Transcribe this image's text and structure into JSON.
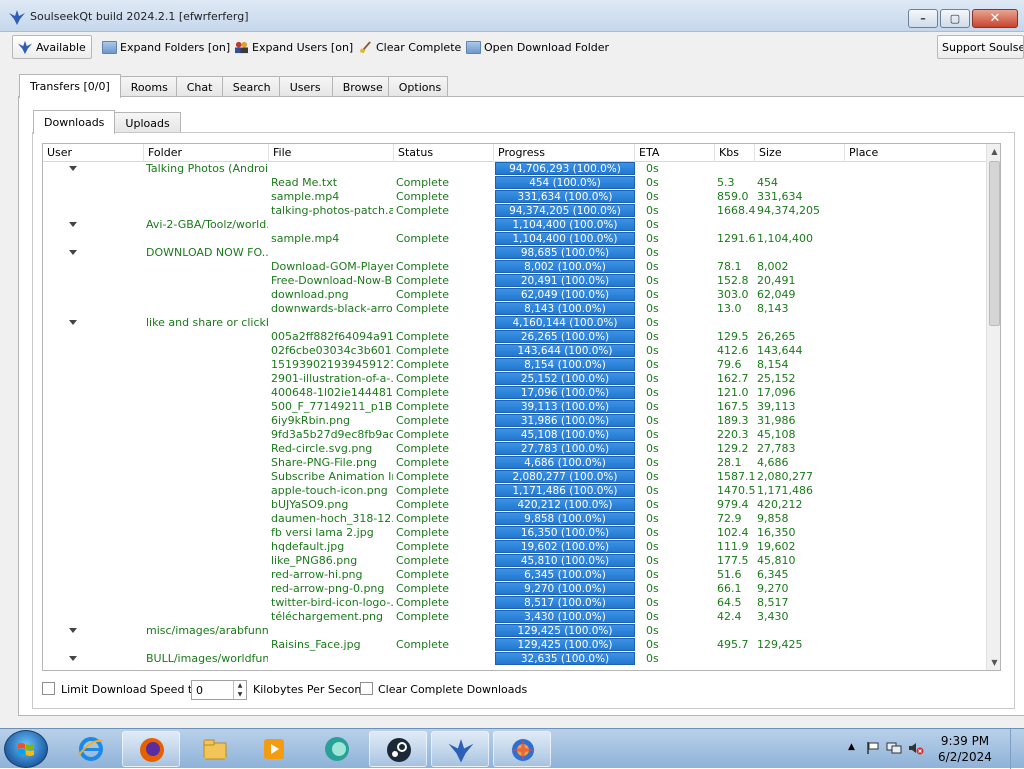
{
  "window": {
    "title": "SoulseekQt build 2024.2.1 [efwrferferg]",
    "minimize": "–",
    "maximize": "▢",
    "close": "✕"
  },
  "toolbar": {
    "available": "Available",
    "expand_folders": "Expand Folders [on]",
    "expand_users": "Expand Users [on]",
    "clear_complete": "Clear Complete",
    "open_download_folder": "Open Download Folder",
    "support": "Support Soulseek"
  },
  "tabs": [
    "Transfers [0/0]",
    "Rooms",
    "Chat",
    "Search",
    "Users",
    "Browse",
    "Options"
  ],
  "subtabs": [
    "Downloads",
    "Uploads"
  ],
  "columns": [
    "User",
    "Folder",
    "File",
    "Status",
    "Progress",
    "ETA",
    "Kbs",
    "Size",
    "Place"
  ],
  "rows": [
    {
      "group": true,
      "folder": "Talking Photos (Androi...",
      "progress": "94,706,293 (100.0%)",
      "eta": "0s"
    },
    {
      "file": "Read Me.txt",
      "status": "Complete",
      "progress": "454 (100.0%)",
      "eta": "0s",
      "kbs": "5.3",
      "size": "454"
    },
    {
      "file": "sample.mp4",
      "status": "Complete",
      "progress": "331,634 (100.0%)",
      "eta": "0s",
      "kbs": "859.0",
      "size": "331,634"
    },
    {
      "file": "talking-photos-patch.a...",
      "status": "Complete",
      "progress": "94,374,205 (100.0%)",
      "eta": "0s",
      "kbs": "1668.4",
      "size": "94,374,205"
    },
    {
      "group": true,
      "folder": "Avi-2-GBA/Toolz/world...",
      "progress": "1,104,400 (100.0%)",
      "eta": "0s"
    },
    {
      "file": "sample.mp4",
      "status": "Complete",
      "progress": "1,104,400 (100.0%)",
      "eta": "0s",
      "kbs": "1291.6",
      "size": "1,104,400"
    },
    {
      "group": true,
      "folder": "DOWNLOAD NOW FO...",
      "progress": "98,685 (100.0%)",
      "eta": "0s"
    },
    {
      "file": "Download-GOM-Player ...",
      "status": "Complete",
      "progress": "8,002 (100.0%)",
      "eta": "0s",
      "kbs": "78.1",
      "size": "8,002"
    },
    {
      "file": "Free-Download-Now-B...",
      "status": "Complete",
      "progress": "20,491 (100.0%)",
      "eta": "0s",
      "kbs": "152.8",
      "size": "20,491"
    },
    {
      "file": "download.png",
      "status": "Complete",
      "progress": "62,049 (100.0%)",
      "eta": "0s",
      "kbs": "303.0",
      "size": "62,049"
    },
    {
      "file": "downwards-black-arro...",
      "status": "Complete",
      "progress": "8,143 (100.0%)",
      "eta": "0s",
      "kbs": "13.0",
      "size": "8,143"
    },
    {
      "group": true,
      "folder": "like and share or clickb...",
      "progress": "4,160,144 (100.0%)",
      "eta": "0s"
    },
    {
      "file": "005a2ff882f64094a91...",
      "status": "Complete",
      "progress": "26,265 (100.0%)",
      "eta": "0s",
      "kbs": "129.5",
      "size": "26,265"
    },
    {
      "file": "02f6cbe03034c3b601...",
      "status": "Complete",
      "progress": "143,644 (100.0%)",
      "eta": "0s",
      "kbs": "412.6",
      "size": "143,644"
    },
    {
      "file": "151939021939459121...",
      "status": "Complete",
      "progress": "8,154 (100.0%)",
      "eta": "0s",
      "kbs": "79.6",
      "size": "8,154"
    },
    {
      "file": "2901-illustration-of-a-...",
      "status": "Complete",
      "progress": "25,152 (100.0%)",
      "eta": "0s",
      "kbs": "162.7",
      "size": "25,152"
    },
    {
      "file": "400648-1l02ie144481...",
      "status": "Complete",
      "progress": "17,096 (100.0%)",
      "eta": "0s",
      "kbs": "121.0",
      "size": "17,096"
    },
    {
      "file": "500_F_77149211_p1B...",
      "status": "Complete",
      "progress": "39,113 (100.0%)",
      "eta": "0s",
      "kbs": "167.5",
      "size": "39,113"
    },
    {
      "file": "6iy9kRbin.png",
      "status": "Complete",
      "progress": "31,986 (100.0%)",
      "eta": "0s",
      "kbs": "189.3",
      "size": "31,986"
    },
    {
      "file": "9fd3a5b27d9ec8fb9ad...",
      "status": "Complete",
      "progress": "45,108 (100.0%)",
      "eta": "0s",
      "kbs": "220.3",
      "size": "45,108"
    },
    {
      "file": "Red-circle.svg.png",
      "status": "Complete",
      "progress": "27,783 (100.0%)",
      "eta": "0s",
      "kbs": "129.2",
      "size": "27,783"
    },
    {
      "file": "Share-PNG-File.png",
      "status": "Complete",
      "progress": "4,686 (100.0%)",
      "eta": "0s",
      "kbs": "28.1",
      "size": "4,686"
    },
    {
      "file": "Subscribe Animation In...",
      "status": "Complete",
      "progress": "2,080,277 (100.0%)",
      "eta": "0s",
      "kbs": "1587.1",
      "size": "2,080,277"
    },
    {
      "file": "apple-touch-icon.png",
      "status": "Complete",
      "progress": "1,171,486 (100.0%)",
      "eta": "0s",
      "kbs": "1470.5",
      "size": "1,171,486"
    },
    {
      "file": "bUJYaSO9.png",
      "status": "Complete",
      "progress": "420,212 (100.0%)",
      "eta": "0s",
      "kbs": "979.4",
      "size": "420,212"
    },
    {
      "file": "daumen-hoch_318-12...",
      "status": "Complete",
      "progress": "9,858 (100.0%)",
      "eta": "0s",
      "kbs": "72.9",
      "size": "9,858"
    },
    {
      "file": "fb versi lama 2.jpg",
      "status": "Complete",
      "progress": "16,350 (100.0%)",
      "eta": "0s",
      "kbs": "102.4",
      "size": "16,350"
    },
    {
      "file": "hqdefault.jpg",
      "status": "Complete",
      "progress": "19,602 (100.0%)",
      "eta": "0s",
      "kbs": "111.9",
      "size": "19,602"
    },
    {
      "file": "like_PNG86.png",
      "status": "Complete",
      "progress": "45,810 (100.0%)",
      "eta": "0s",
      "kbs": "177.5",
      "size": "45,810"
    },
    {
      "file": "red-arrow-hi.png",
      "status": "Complete",
      "progress": "6,345 (100.0%)",
      "eta": "0s",
      "kbs": "51.6",
      "size": "6,345"
    },
    {
      "file": "red-arrow-png-0.png",
      "status": "Complete",
      "progress": "9,270 (100.0%)",
      "eta": "0s",
      "kbs": "66.1",
      "size": "9,270"
    },
    {
      "file": "twitter-bird-icon-logo-...",
      "status": "Complete",
      "progress": "8,517 (100.0%)",
      "eta": "0s",
      "kbs": "64.5",
      "size": "8,517"
    },
    {
      "file": "téléchargement.png",
      "status": "Complete",
      "progress": "3,430 (100.0%)",
      "eta": "0s",
      "kbs": "42.4",
      "size": "3,430"
    },
    {
      "group": true,
      "folder": "misc/images/arabfunn...",
      "progress": "129,425 (100.0%)",
      "eta": "0s"
    },
    {
      "file": "Raisins_Face.jpg",
      "status": "Complete",
      "progress": "129,425 (100.0%)",
      "eta": "0s",
      "kbs": "495.7",
      "size": "129,425"
    },
    {
      "group": true,
      "folder": "BULL/images/worldfun...",
      "progress": "32,635 (100.0%)",
      "eta": "0s"
    }
  ],
  "footer": {
    "limit_label": "Limit Download Speed to",
    "speed_value": "0",
    "units_label": "Kilobytes Per Second",
    "clear_label": "Clear Complete Downloads"
  },
  "taskbar": {
    "icons": [
      "start-orb-icon",
      "internet-explorer-icon",
      "firefox-icon",
      "file-explorer-icon",
      "media-player-icon",
      "app-icon",
      "steam-icon",
      "soulseek-icon",
      "paint-icon"
    ],
    "time": "9:39 PM",
    "date": "6/2/2024"
  }
}
